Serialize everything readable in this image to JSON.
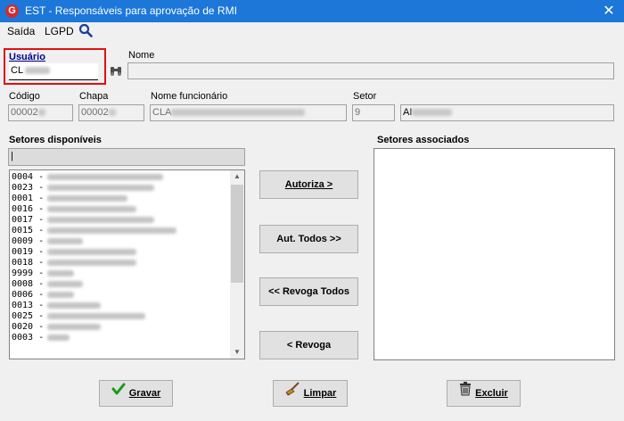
{
  "window": {
    "title": "EST - Responsáveis para aprovação de RMI",
    "close_glyph": "✕"
  },
  "menu": {
    "saida": "Saída",
    "lgpd": "LGPD"
  },
  "usuario": {
    "label": "Usuário",
    "value": "CL"
  },
  "nome": {
    "label": "Nome"
  },
  "codigo": {
    "label": "Código",
    "value": "00002"
  },
  "chapa": {
    "label": "Chapa",
    "value": "00002"
  },
  "nome_funcionario": {
    "label": "Nome funcionário",
    "value": "CLA"
  },
  "setor": {
    "label": "Setor",
    "code": "9",
    "name": "AI"
  },
  "setores_disponiveis": {
    "label": "Setores disponíveis",
    "items": [
      "0004 -",
      "0023 -",
      "0001 -",
      "0016 -",
      "0017 -",
      "0015 -",
      "0009 -",
      "0019 -",
      "0018 -",
      "9999 -",
      "0008 -",
      "0006 -",
      "0013 -",
      "0025 -",
      "0020 -",
      "0003 -"
    ]
  },
  "setores_associados": {
    "label": "Setores associados"
  },
  "buttons": {
    "autoriza": "Autoriza >",
    "aut_todos": "Aut. Todos >>",
    "revoga_todos": "<< Revoga Todos",
    "revoga": "< Revoga",
    "gravar": "Gravar",
    "limpar": "Limpar",
    "excluir": "Excluir"
  }
}
